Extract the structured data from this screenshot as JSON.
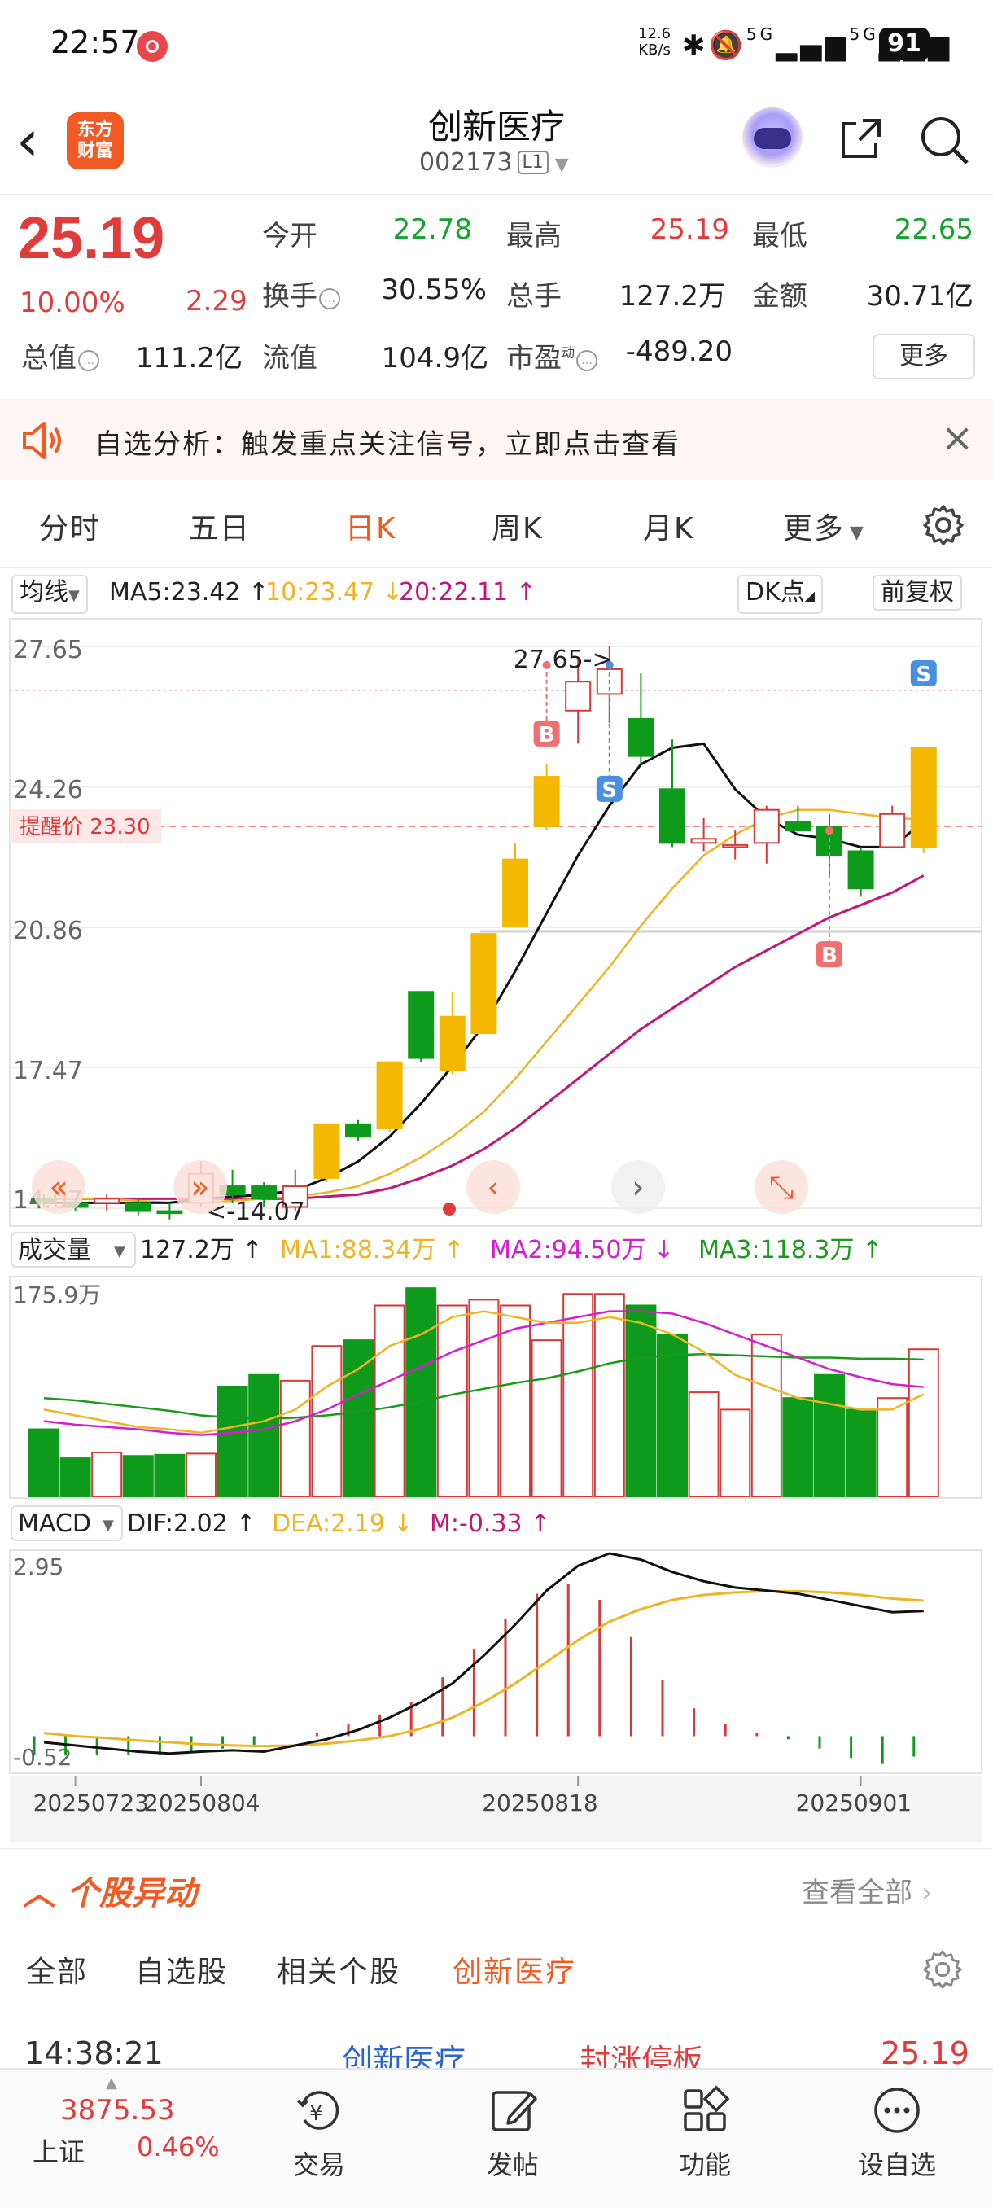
{
  "status": {
    "time": "22:57",
    "net_speed_top": "12.6",
    "net_speed_bottom": "KB/s",
    "net_label": "5G",
    "net_label2": "5G",
    "battery": "91"
  },
  "header": {
    "title": "创新医疗",
    "code": "002173",
    "level": "L1",
    "logo": "东方财富"
  },
  "quote": {
    "price": "25.19",
    "pct": "10.00%",
    "chg": "2.29",
    "rows": [
      {
        "l1": "今开",
        "v1": "22.78",
        "c1": "green",
        "l2": "最高",
        "v2": "25.19",
        "c2": "red",
        "l3": "最低",
        "v3": "22.65",
        "c3": "green"
      },
      {
        "l1": "换手",
        "v1": "30.55%",
        "c1": "dark",
        "l2": "总手",
        "v2": "127.2万",
        "c2": "dark",
        "l3": "金额",
        "v3": "30.71亿",
        "c3": "dark"
      }
    ],
    "row3": {
      "l1": "总值",
      "v1": "111.2亿",
      "l2": "流值",
      "v2": "104.9亿",
      "l3": "市盈",
      "v3": "-489.20",
      "dyn": "动"
    },
    "more": "更多"
  },
  "alert": {
    "text": "自选分析：触发重点关注信号，立即点击查看"
  },
  "tabs": [
    "分时",
    "五日",
    "日K",
    "周K",
    "月K",
    "更多"
  ],
  "active_tab": "日K",
  "ma_bar": {
    "select": "均线",
    "ma5": "MA5:23.42 ↑",
    "ma10": "10:23.47 ↓",
    "ma20": "20:22.11 ↑",
    "dk": "DK点",
    "fq": "前复权"
  },
  "kline_labels": {
    "y": [
      "27.65",
      "24.26",
      "20.86",
      "17.47",
      "14.07"
    ],
    "hi_marker": "27.65->",
    "lo_marker": "<-14.07",
    "alert_label": "提醒价 23.30",
    "b": "B",
    "s": "S"
  },
  "vol_bar": {
    "select": "成交量",
    "vol": "127.2万 ↑",
    "ma1": "MA1:88.34万 ↑",
    "ma2": "MA2:94.50万 ↓",
    "ma3": "MA3:118.3万 ↑",
    "ytop": "175.9万"
  },
  "macd_bar": {
    "select": "MACD",
    "dif": "DIF:2.02 ↑",
    "dea": "DEA:2.19 ↓",
    "m": "M:-0.33 ↑",
    "ytop": "2.95",
    "ybot": "-0.52"
  },
  "dates": [
    "20250723",
    "20250804",
    "20250818",
    "20250901"
  ],
  "colors": {
    "up": "#f5b800",
    "down": "#0e9a1a",
    "up_red": "#d53a3a",
    "accent": "#f15a22",
    "ma5": "#111111",
    "ma10": "#f0b323",
    "ma20": "#c0187a",
    "macd_dea": "#f0b323",
    "vol_ma3": "#1a9a1a",
    "vol_ma2": "#d61ccf"
  },
  "chart_data": {
    "type": "candlestick",
    "candles": [
      {
        "o": 14.3,
        "h": 14.4,
        "l": 14.1,
        "c": 14.2
      },
      {
        "o": 14.2,
        "h": 14.3,
        "l": 14.0,
        "c": 14.1
      },
      {
        "o": 14.2,
        "h": 14.4,
        "l": 14.0,
        "c": 14.3
      },
      {
        "o": 14.2,
        "h": 14.3,
        "l": 13.9,
        "c": 14.0
      },
      {
        "o": 14.0,
        "h": 14.2,
        "l": 13.8,
        "c": 13.95
      },
      {
        "o": 14.2,
        "h": 15.2,
        "l": 14.1,
        "c": 14.9
      },
      {
        "o": 14.6,
        "h": 15.0,
        "l": 14.2,
        "c": 14.4
      },
      {
        "o": 14.6,
        "h": 14.7,
        "l": 14.1,
        "c": 14.3
      },
      {
        "o": 14.1,
        "h": 15.0,
        "l": 14.0,
        "c": 14.6
      },
      {
        "o": 14.8,
        "h": 16.1,
        "l": 14.7,
        "c": 16.1
      },
      {
        "o": 16.1,
        "h": 16.2,
        "l": 15.7,
        "c": 15.8
      },
      {
        "o": 16.0,
        "h": 17.6,
        "l": 15.9,
        "c": 17.6
      },
      {
        "o": 19.3,
        "h": 19.3,
        "l": 17.6,
        "c": 17.7
      },
      {
        "o": 17.4,
        "h": 19.3,
        "l": 17.3,
        "c": 18.7
      },
      {
        "o": 18.3,
        "h": 20.7,
        "l": 18.3,
        "c": 20.7
      },
      {
        "o": 20.9,
        "h": 22.9,
        "l": 20.9,
        "c": 22.5
      },
      {
        "o": 23.3,
        "h": 24.8,
        "l": 23.2,
        "c": 24.5
      },
      {
        "o": 26.1,
        "h": 27.4,
        "l": 25.3,
        "c": 26.8
      },
      {
        "o": 26.5,
        "h": 27.65,
        "l": 25.8,
        "c": 27.1
      },
      {
        "o": 25.9,
        "h": 27.0,
        "l": 24.8,
        "c": 25.0
      },
      {
        "o": 24.2,
        "h": 25.4,
        "l": 22.8,
        "c": 22.9
      },
      {
        "o": 22.9,
        "h": 23.5,
        "l": 22.7,
        "c": 23.0
      },
      {
        "o": 22.8,
        "h": 23.2,
        "l": 22.5,
        "c": 22.85
      },
      {
        "o": 22.9,
        "h": 23.8,
        "l": 22.4,
        "c": 23.7
      },
      {
        "o": 23.4,
        "h": 23.8,
        "l": 23.2,
        "c": 23.2
      },
      {
        "o": 23.3,
        "h": 23.6,
        "l": 22.1,
        "c": 22.6
      },
      {
        "o": 22.7,
        "h": 22.8,
        "l": 21.6,
        "c": 21.8
      },
      {
        "o": 22.8,
        "h": 23.8,
        "l": 22.8,
        "c": 23.6
      },
      {
        "o": 22.8,
        "h": 25.19,
        "l": 22.65,
        "c": 25.19
      }
    ],
    "ma5": [
      14.2,
      14.2,
      14.2,
      14.2,
      14.2,
      14.3,
      14.35,
      14.4,
      14.5,
      14.8,
      15.2,
      15.8,
      16.6,
      17.5,
      18.5,
      19.8,
      21.2,
      22.6,
      23.8,
      24.8,
      25.2,
      25.3,
      24.2,
      23.5,
      23.1,
      23.0,
      22.8,
      22.8,
      23.42
    ],
    "ma10": [
      14.3,
      14.3,
      14.3,
      14.25,
      14.2,
      14.2,
      14.25,
      14.3,
      14.35,
      14.45,
      14.6,
      14.9,
      15.3,
      15.8,
      16.4,
      17.2,
      18.1,
      19.0,
      19.9,
      20.9,
      21.8,
      22.6,
      23.1,
      23.5,
      23.7,
      23.7,
      23.6,
      23.5,
      23.47
    ],
    "ma20": [
      14.3,
      14.3,
      14.3,
      14.3,
      14.3,
      14.3,
      14.3,
      14.3,
      14.3,
      14.35,
      14.4,
      14.55,
      14.8,
      15.1,
      15.5,
      16.0,
      16.6,
      17.2,
      17.8,
      18.4,
      18.9,
      19.4,
      19.9,
      20.3,
      20.7,
      21.1,
      21.4,
      21.7,
      22.11
    ],
    "alert_price": 23.3,
    "y_ticks": [
      27.65,
      24.26,
      20.86,
      17.47,
      14.07
    ],
    "volume": [
      58,
      33,
      38,
      35,
      36,
      37,
      95,
      105,
      100,
      130,
      135,
      165,
      180,
      165,
      170,
      165,
      135,
      175,
      175,
      165,
      140,
      90,
      75,
      140,
      85,
      105,
      75,
      85,
      127.2
    ],
    "vol_ma1": [
      75,
      70,
      65,
      60,
      58,
      55,
      60,
      65,
      75,
      95,
      110,
      130,
      140,
      155,
      160,
      155,
      150,
      150,
      155,
      150,
      140,
      125,
      105,
      95,
      85,
      80,
      75,
      75,
      88.34
    ],
    "vol_ma2": [
      65,
      62,
      60,
      58,
      55,
      53,
      55,
      58,
      65,
      75,
      88,
      100,
      112,
      125,
      135,
      145,
      150,
      155,
      160,
      160,
      158,
      150,
      140,
      130,
      120,
      110,
      103,
      97,
      94.5
    ],
    "vol_ma3": [
      85,
      83,
      80,
      77,
      74,
      70,
      68,
      67,
      68,
      70,
      73,
      77,
      82,
      88,
      93,
      98,
      102,
      108,
      115,
      120,
      122,
      123,
      122,
      121,
      120,
      120,
      119,
      119,
      118.3
    ],
    "vol_ymax": 175.9,
    "macd_dif": [
      -0.1,
      -0.15,
      -0.2,
      -0.25,
      -0.28,
      -0.25,
      -0.23,
      -0.25,
      -0.15,
      -0.05,
      0.1,
      0.3,
      0.55,
      0.85,
      1.3,
      1.8,
      2.35,
      2.75,
      2.95,
      2.85,
      2.65,
      2.5,
      2.4,
      2.35,
      2.3,
      2.2,
      2.1,
      2.0,
      2.02
    ],
    "macd_dea": [
      0.05,
      0.0,
      -0.03,
      -0.07,
      -0.1,
      -0.13,
      -0.15,
      -0.16,
      -0.15,
      -0.12,
      -0.07,
      0.0,
      0.12,
      0.3,
      0.55,
      0.85,
      1.2,
      1.55,
      1.85,
      2.05,
      2.2,
      2.28,
      2.32,
      2.34,
      2.34,
      2.32,
      2.28,
      2.22,
      2.19
    ],
    "macd_m": [
      -0.3,
      -0.3,
      -0.3,
      -0.3,
      -0.3,
      -0.25,
      -0.2,
      -0.18,
      0.0,
      0.05,
      0.2,
      0.35,
      0.55,
      0.95,
      1.4,
      1.9,
      2.3,
      2.45,
      2.2,
      1.6,
      0.9,
      0.45,
      0.2,
      0.05,
      -0.05,
      -0.2,
      -0.35,
      -0.45,
      -0.33
    ],
    "macd_ymax": 2.95,
    "macd_ymin": -0.52
  },
  "movers": {
    "title": "个股异动",
    "all": "查看全部",
    "tabs": [
      "全部",
      "自选股",
      "相关个股",
      "创新医疗"
    ],
    "active": "创新医疗",
    "peek_time": "14:38:21",
    "peek_name": "创新医疗",
    "peek_event": "封涨停板",
    "peek_price": "25.19"
  },
  "bottom": {
    "index": "3875.53",
    "index_name": "上证",
    "index_pct": "0.46%",
    "items": [
      "交易",
      "发帖",
      "功能",
      "设自选"
    ]
  }
}
